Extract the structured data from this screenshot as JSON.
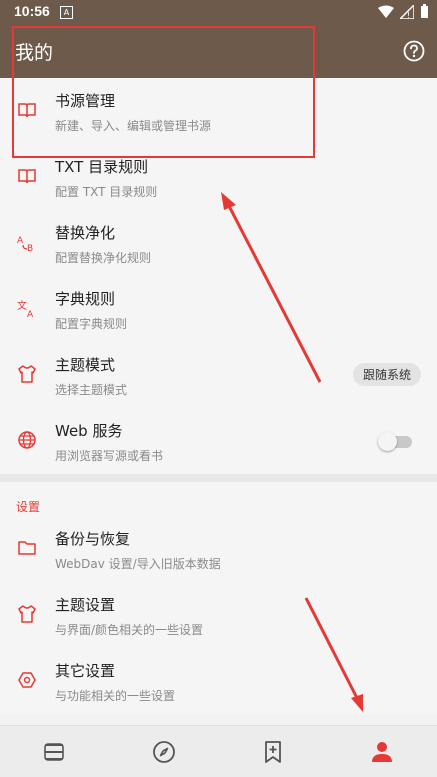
{
  "status": {
    "time": "10:56",
    "notif_glyph": "A"
  },
  "appbar": {
    "title": "我的"
  },
  "items": [
    {
      "title": "书源管理",
      "subtitle": "新建、导入、编辑或管理书源",
      "icon": "book-icon"
    },
    {
      "title": "TXT 目录规则",
      "subtitle": "配置 TXT 目录规则",
      "icon": "book-icon"
    },
    {
      "title": "替换净化",
      "subtitle": "配置替换净化规则",
      "icon": "replace-icon"
    },
    {
      "title": "字典规则",
      "subtitle": "配置字典规则",
      "icon": "translate-icon"
    },
    {
      "title": "主题模式",
      "subtitle": "选择主题模式",
      "icon": "shirt-icon",
      "chip": "跟随系统"
    },
    {
      "title": "Web 服务",
      "subtitle": "用浏览器写源或看书",
      "icon": "globe-icon",
      "toggle": false
    }
  ],
  "settings": {
    "header": "设置",
    "items": [
      {
        "title": "备份与恢复",
        "subtitle": "WebDav 设置/导入旧版本数据",
        "icon": "folder-icon"
      },
      {
        "title": "主题设置",
        "subtitle": "与界面/颜色相关的一些设置",
        "icon": "shirt-icon"
      },
      {
        "title": "其它设置",
        "subtitle": "与功能相关的一些设置",
        "icon": "hexagon-icon"
      }
    ]
  },
  "bottom_nav": {
    "active": "my",
    "items": [
      "bookshelf-icon",
      "discover-icon",
      "rss-icon",
      "my-icon"
    ]
  },
  "colors": {
    "appbar": "#6e5a4a",
    "accent": "#e53935",
    "annotation": "#e53935"
  }
}
